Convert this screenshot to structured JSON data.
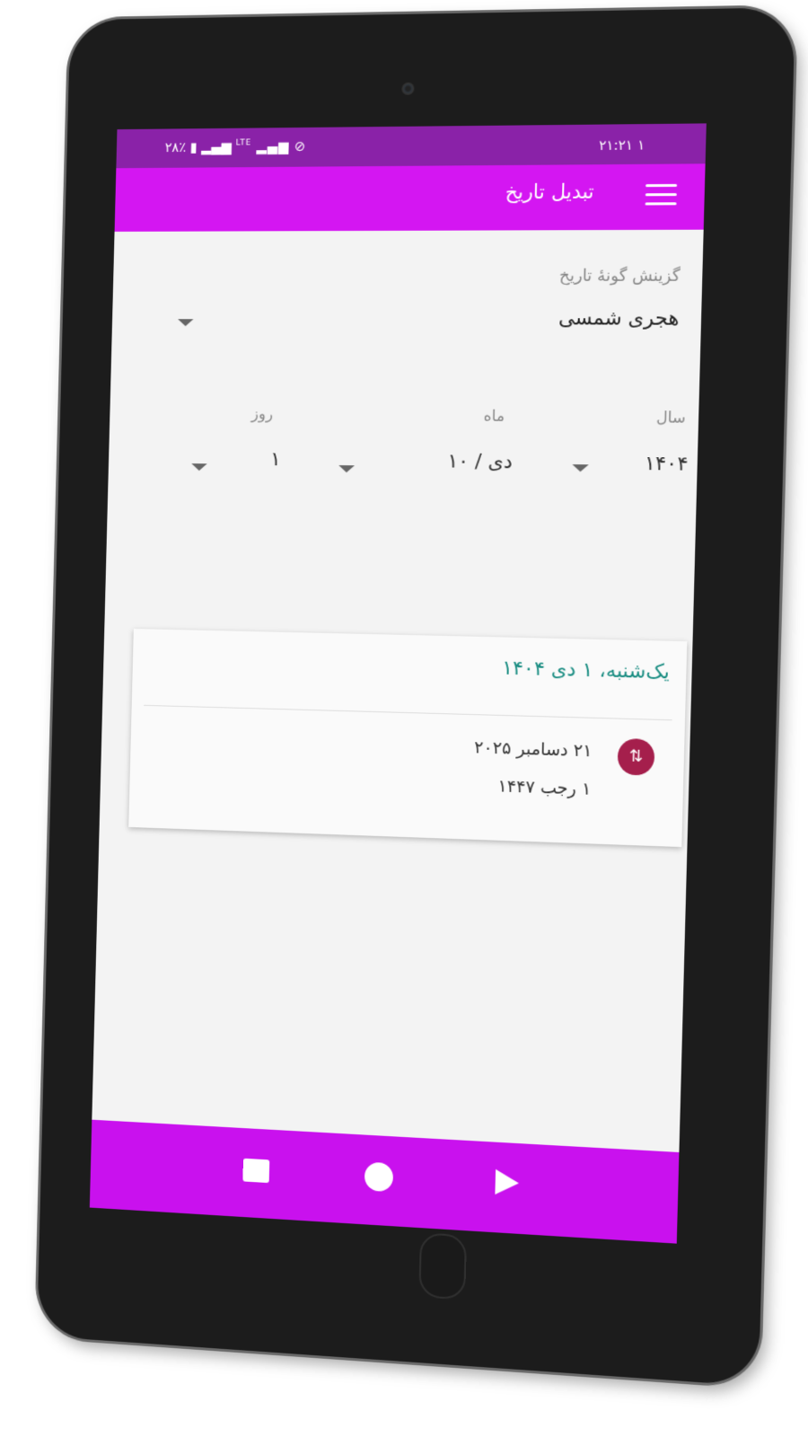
{
  "status_bar": {
    "battery": "٢٨٪",
    "signal": "LTE",
    "time": "٢١:٢١",
    "notification_count": "١"
  },
  "app_bar": {
    "title": "تبدیل تاریخ",
    "menu_icon": "hamburger-menu-icon"
  },
  "date_type": {
    "label": "گزینش گونهٔ تاریخ",
    "selected": "هجری شمسی"
  },
  "date_fields": {
    "year": {
      "label": "سال",
      "value": "۱۴۰۴"
    },
    "month": {
      "label": "ماه",
      "value": "دی / ۱۰"
    },
    "day": {
      "label": "روز",
      "value": "۱"
    }
  },
  "result_card": {
    "title": "یک‌شنبه، ۱ دی ۱۴۰۴",
    "gregorian": "۲۱ دسامبر ۲۰۲۵",
    "hijri": "۱ رجب ۱۴۴۷",
    "icon": "swap-icon"
  },
  "nav_bar": {
    "back_icon": "back-triangle-icon",
    "home_icon": "home-circle-icon",
    "recent_icon": "recent-square-icon"
  },
  "colors": {
    "status_bar": "#8a22a8",
    "app_bar": "#d416f2",
    "nav_bar": "#c911ee",
    "card_title": "#1a8d82",
    "swap_icon_bg": "#a51f4c"
  }
}
